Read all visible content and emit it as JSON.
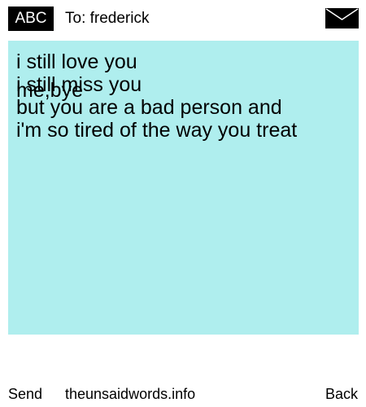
{
  "header": {
    "badge_label": "ABC",
    "to_text": "To: frederick",
    "envelope_icon": "envelope-icon"
  },
  "message": {
    "background_color": "#afeeee",
    "lines": [
      "i still love you",
      "i still miss you",
      "but you are  a bad person and",
      "i'm so tired of the way you treat",
      "me,bye"
    ]
  },
  "footer": {
    "send_label": "Send",
    "site_label": "theunsaidwords.info",
    "back_label": "Back"
  }
}
